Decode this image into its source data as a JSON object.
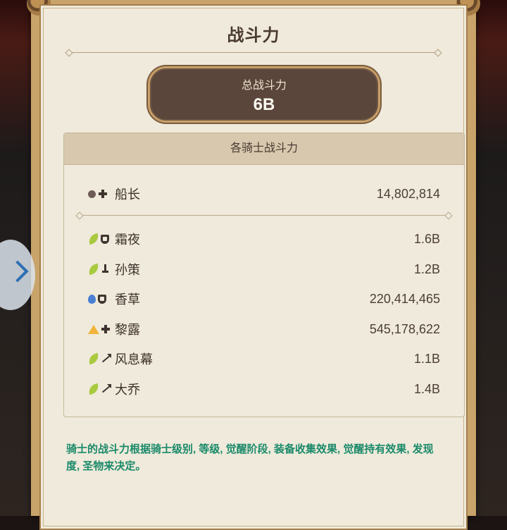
{
  "dialog": {
    "title": "战斗力"
  },
  "total": {
    "label": "总战斗力",
    "value": "6B"
  },
  "knights_section": {
    "header": "各骑士战斗力"
  },
  "captain": {
    "name": "船长",
    "value": "14,802,814",
    "icons": [
      "dot-icon",
      "plus-icon"
    ]
  },
  "knights": [
    {
      "name": "霜夜",
      "value": "1.6B",
      "icons": [
        "leaf-icon",
        "shield-icon"
      ]
    },
    {
      "name": "孙策",
      "value": "1.2B",
      "icons": [
        "leaf-icon",
        "sword-icon"
      ]
    },
    {
      "name": "香草",
      "value": "220,414,465",
      "icons": [
        "drop-icon",
        "shield-icon"
      ]
    },
    {
      "name": "黎露",
      "value": "545,178,622",
      "icons": [
        "triangle-icon",
        "plus-icon"
      ]
    },
    {
      "name": "风息幕",
      "value": "1.1B",
      "icons": [
        "leaf-icon",
        "arrow-icon"
      ]
    },
    {
      "name": "大乔",
      "value": "1.4B",
      "icons": [
        "leaf-icon",
        "arrow-icon"
      ]
    }
  ],
  "footnote": "骑士的战斗力根据骑士级别, 等级, 觉醒阶段, 装备收集效果, 觉醒持有效果, 发现度, 圣物来决定。",
  "colors": {
    "panel_bg": "#efeadb",
    "frame": "#c8a36a",
    "total_box": "#5a463b",
    "footnote_text": "#1b8a6a",
    "nav_chevron": "#2e6fb3"
  }
}
